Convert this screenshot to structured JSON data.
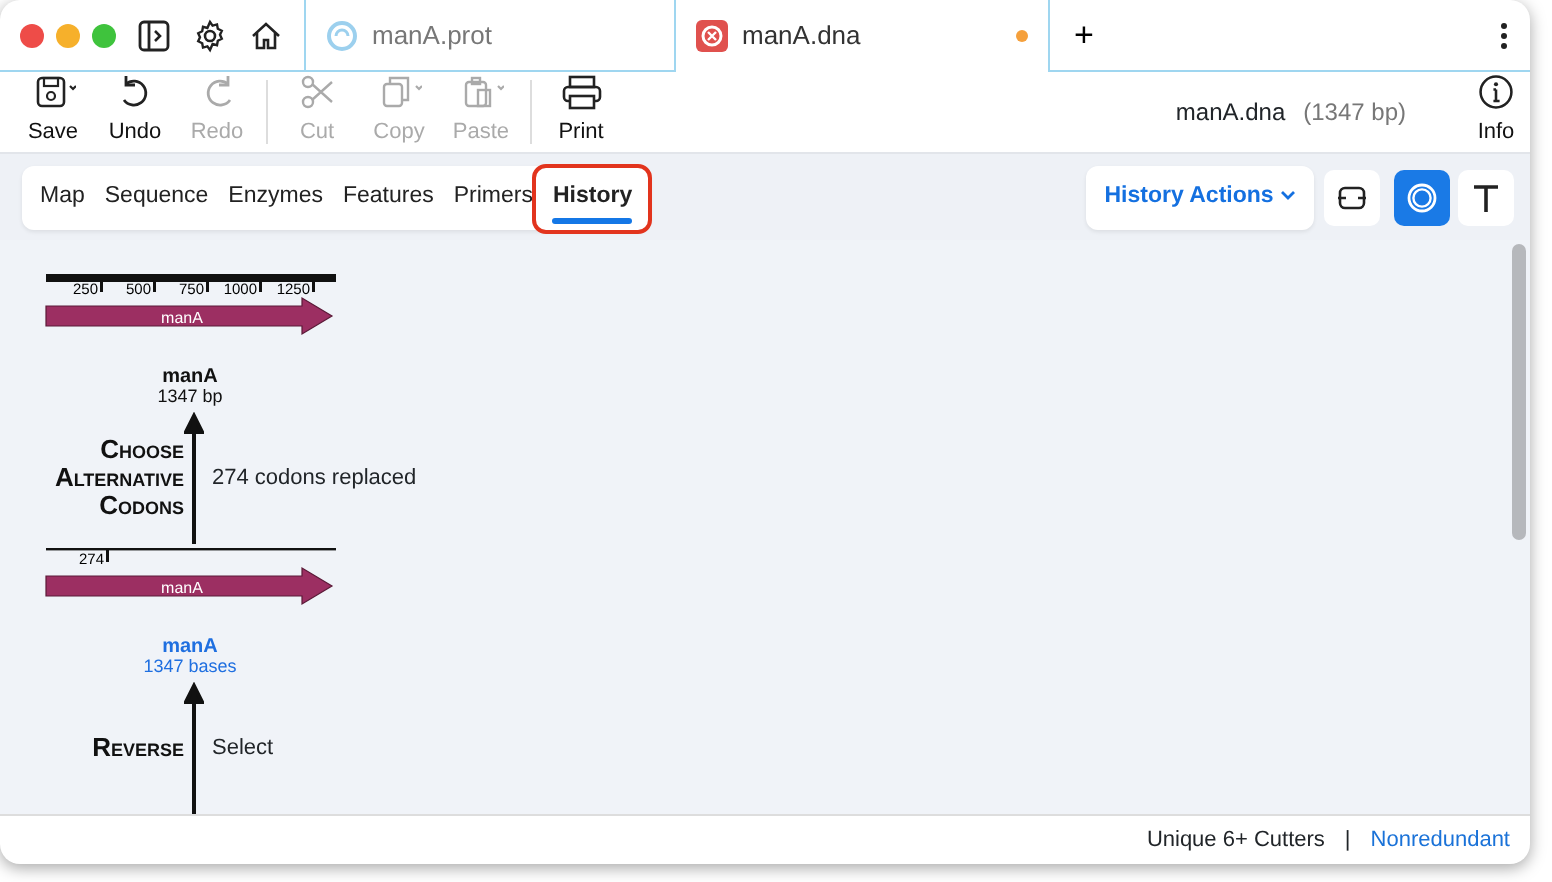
{
  "file_tabs": [
    {
      "label": "manA.prot",
      "selected": false,
      "kind": "protein",
      "unsaved": false
    },
    {
      "label": "manA.dna",
      "selected": true,
      "kind": "dna",
      "unsaved": true
    }
  ],
  "new_tab": "+",
  "toolbar_groups": [
    [
      {
        "label": "Save",
        "kind": "save",
        "disabled": false,
        "menu": true
      },
      {
        "label": "Undo",
        "kind": "undo",
        "disabled": false,
        "menu": false
      },
      {
        "label": "Redo",
        "kind": "redo",
        "disabled": true,
        "menu": false
      }
    ],
    [
      {
        "label": "Cut",
        "kind": "cut",
        "disabled": true,
        "menu": false
      },
      {
        "label": "Copy",
        "kind": "copy",
        "disabled": true,
        "menu": true
      },
      {
        "label": "Paste",
        "kind": "paste",
        "disabled": true,
        "menu": true
      }
    ],
    [
      {
        "label": "Print",
        "kind": "print",
        "disabled": false,
        "menu": false
      }
    ]
  ],
  "document": {
    "name": "manA.dna",
    "length": "(1347 bp)"
  },
  "info_button": "Info",
  "view_tabs": [
    {
      "label": "Map",
      "selected": false,
      "annotated": false
    },
    {
      "label": "Sequence",
      "selected": false,
      "annotated": false
    },
    {
      "label": "Enzymes",
      "selected": false,
      "annotated": false
    },
    {
      "label": "Features",
      "selected": false,
      "annotated": false
    },
    {
      "label": "Primers",
      "selected": false,
      "annotated": false
    },
    {
      "label": "History",
      "selected": true,
      "annotated": true
    }
  ],
  "history_actions": "History Actions",
  "view_toggles": [
    {
      "kind": "collapse",
      "selected": false
    },
    {
      "kind": "circle",
      "selected": true
    },
    {
      "kind": "text",
      "selected": false
    }
  ],
  "history": [
    {
      "kind": "map",
      "thick_ruler": true,
      "ticks": [
        "250",
        "500",
        "750",
        "1000",
        "1250"
      ],
      "feature": "manA",
      "name": "manA",
      "size": "1347 bp",
      "current": false
    },
    {
      "kind": "step",
      "operation": "Choose Alternative Codons",
      "note": "274 codons replaced"
    },
    {
      "kind": "map",
      "thick_ruler": false,
      "ticks": [
        "274"
      ],
      "feature": "manA",
      "name": "manA",
      "size": "1347 bases",
      "current": true
    },
    {
      "kind": "step",
      "operation": "Reverse",
      "note": "Select"
    }
  ],
  "status_bar": {
    "enzymes": "Unique 6+ Cutters",
    "separator": "|",
    "mode": "Nonredundant"
  }
}
